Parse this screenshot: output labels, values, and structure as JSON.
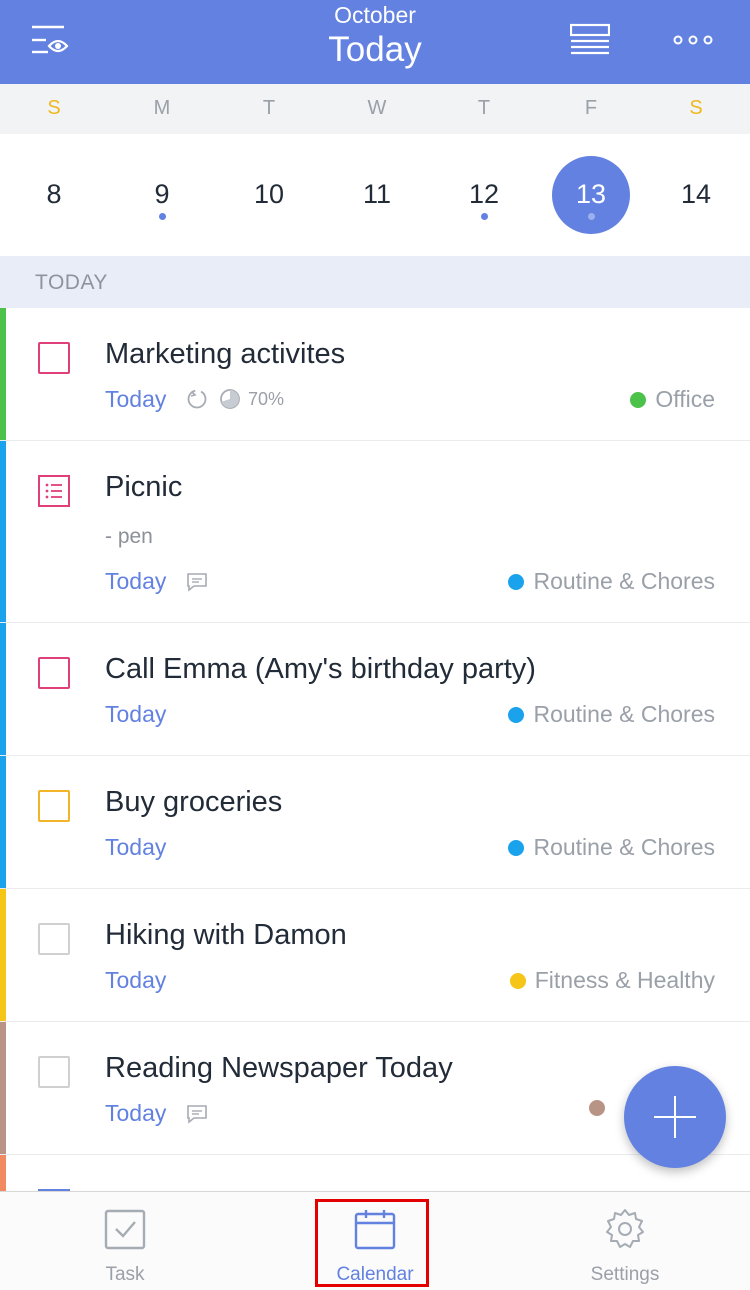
{
  "header": {
    "month": "October",
    "title": "Today",
    "left_icon": "filter-eye-icon",
    "list_icon": "list-view-icon",
    "more_icon": "more-dots-icon",
    "background": "#6281e1"
  },
  "week": {
    "weekdays": [
      "S",
      "M",
      "T",
      "W",
      "T",
      "F",
      "S"
    ],
    "days": [
      "8",
      "9",
      "10",
      "11",
      "12",
      "13",
      "14"
    ],
    "selected_day": "13",
    "days_with_tasks": [
      "9",
      "12",
      "13"
    ]
  },
  "section": {
    "label": "TODAY"
  },
  "tasks": [
    {
      "title": "Marketing activites",
      "due": "Today",
      "progress": "70%",
      "progress_value": 0.7,
      "icons": [
        "repeat-icon",
        "progress-pie-icon"
      ],
      "category": "Office",
      "category_color": "#4cc24a",
      "bar_color": "#4cc24a",
      "checkbox_color": "#e0407a"
    },
    {
      "title": "Picnic",
      "note": "- pen",
      "due": "Today",
      "icons": [
        "comment-icon"
      ],
      "category": "Routine & Chores",
      "category_color": "#1aa3ec",
      "bar_color": "#1aa3ec",
      "checkbox_color": "#e0407a",
      "checkbox_type": "checklist"
    },
    {
      "title": "Call Emma (Amy's birthday party)",
      "due": "Today",
      "category": "Routine & Chores",
      "category_color": "#1aa3ec",
      "bar_color": "#1aa3ec",
      "checkbox_color": "#e0407a"
    },
    {
      "title": "Buy groceries",
      "due": "Today",
      "category": "Routine & Chores",
      "category_color": "#1aa3ec",
      "bar_color": "#1aa3ec",
      "checkbox_color": "#f2b52a"
    },
    {
      "title": "Hiking with Damon",
      "due": "Today",
      "category": "Fitness & Healthy",
      "category_color": "#f5c518",
      "bar_color": "#f5c518",
      "checkbox_color": "#d0d0d0"
    },
    {
      "title": "Reading Newspaper Today",
      "due": "Today",
      "icons": [
        "comment-icon"
      ],
      "category_color": "#b89486",
      "bar_color": "#b89486",
      "checkbox_color": "#d0d0d0"
    }
  ],
  "fab": {
    "icon": "plus-icon"
  },
  "tabs": [
    {
      "label": "Task",
      "icon": "checkbox-icon"
    },
    {
      "label": "Calendar",
      "icon": "calendar-icon",
      "active": true
    },
    {
      "label": "Settings",
      "icon": "gear-icon"
    }
  ],
  "colors": {
    "accent": "#6281e1",
    "weekend": "#f0b820",
    "highlight_box": "#e30000"
  }
}
